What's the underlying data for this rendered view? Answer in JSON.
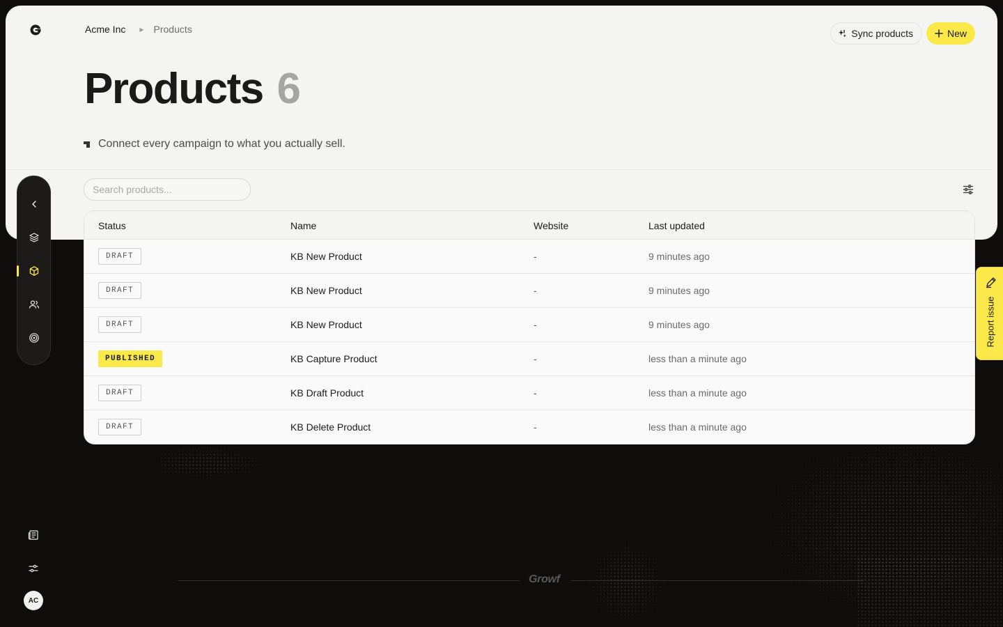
{
  "breadcrumb": {
    "org": "Acme Inc",
    "page": "Products"
  },
  "actions": {
    "sync_label": "Sync products",
    "new_label": "New"
  },
  "page": {
    "title": "Products",
    "count": "6",
    "subtitle": "Connect every campaign to what you actually sell."
  },
  "search": {
    "placeholder": "Search products..."
  },
  "table": {
    "headers": {
      "status": "Status",
      "name": "Name",
      "website": "Website",
      "updated": "Last updated"
    },
    "rows": [
      {
        "status": "DRAFT",
        "name": "KB New Product",
        "website": "-",
        "updated": "9 minutes ago"
      },
      {
        "status": "DRAFT",
        "name": "KB New Product",
        "website": "-",
        "updated": "9 minutes ago"
      },
      {
        "status": "DRAFT",
        "name": "KB New Product",
        "website": "-",
        "updated": "9 minutes ago"
      },
      {
        "status": "PUBLISHED",
        "name": "KB Capture Product",
        "website": "-",
        "updated": "less than a minute ago"
      },
      {
        "status": "DRAFT",
        "name": "KB Draft Product",
        "website": "-",
        "updated": "less than a minute ago"
      },
      {
        "status": "DRAFT",
        "name": "KB Delete Product",
        "website": "-",
        "updated": "less than a minute ago"
      }
    ]
  },
  "report": {
    "label": "Report issue"
  },
  "user": {
    "initials": "AC"
  },
  "footer": {
    "brand": "Growf"
  },
  "sidebar": {
    "icons": [
      "chevron-left-icon",
      "layers-icon",
      "box-icon",
      "users-icon",
      "target-icon"
    ],
    "active": "box-icon"
  },
  "colors": {
    "accent": "#fbe94a",
    "background": "#0e0d0c",
    "panel": "#f4f4f3"
  }
}
